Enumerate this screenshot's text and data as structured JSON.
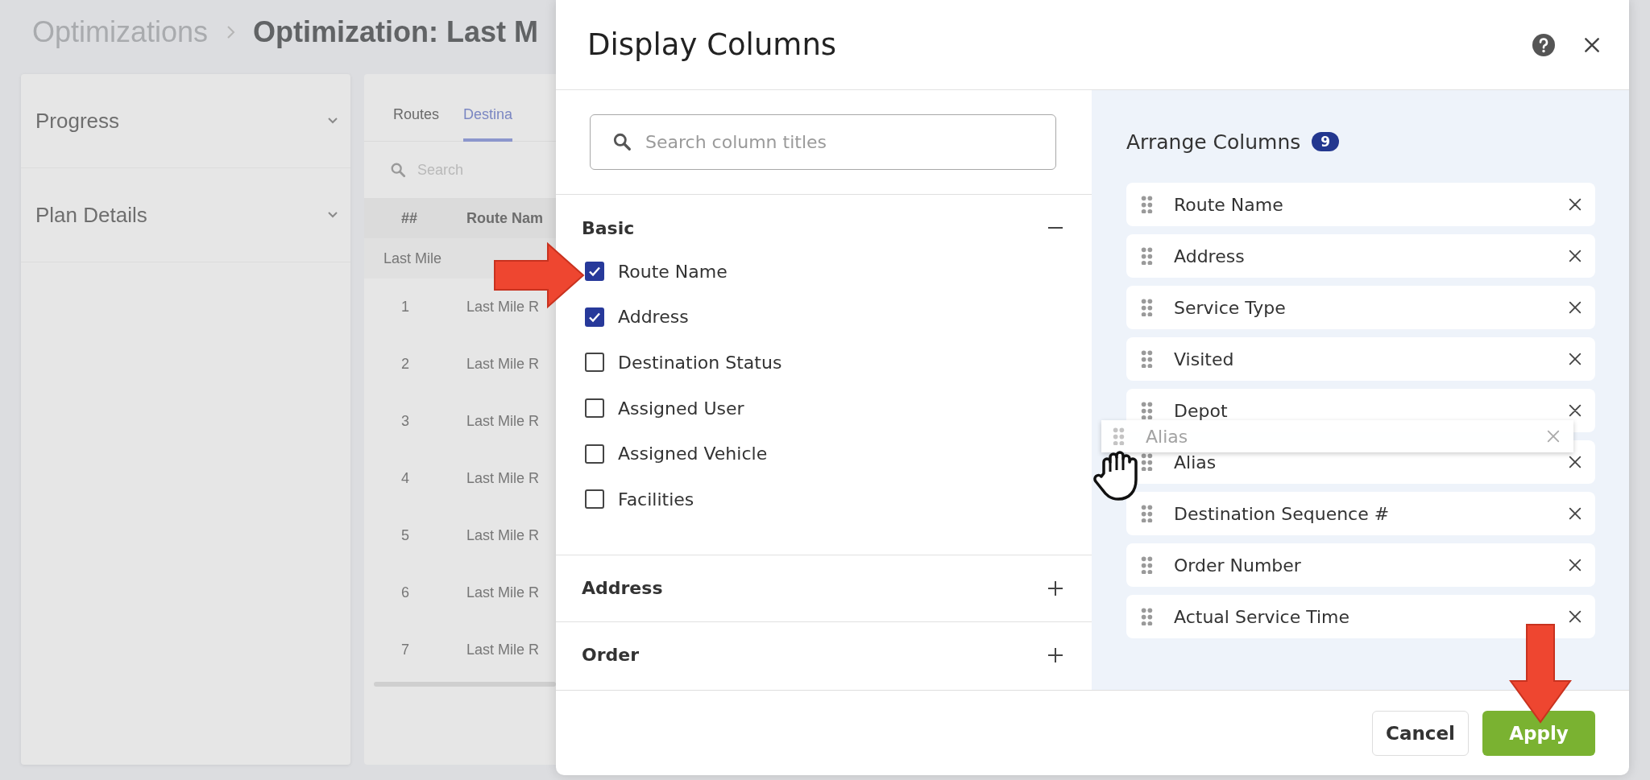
{
  "breadcrumb": [
    {
      "label": "Optimizations"
    },
    {
      "label": "Optimization: Last M"
    }
  ],
  "sidebar": {
    "sections": [
      {
        "label": "Progress"
      },
      {
        "label": "Plan Details"
      }
    ]
  },
  "tabs": [
    {
      "label": "Routes",
      "selected": false
    },
    {
      "label": "Destina",
      "selected": true
    }
  ],
  "table_search": {
    "placeholder": "Search"
  },
  "table": {
    "columns": [
      "##",
      "Route Nam"
    ],
    "group_row": "Last Mile",
    "rows": [
      {
        "number": "1",
        "route": "Last Mile R"
      },
      {
        "number": "2",
        "route": "Last Mile R"
      },
      {
        "number": "3",
        "route": "Last Mile R"
      },
      {
        "number": "4",
        "route": "Last Mile R"
      },
      {
        "number": "5",
        "route": "Last Mile R"
      },
      {
        "number": "6",
        "route": "Last Mile R"
      },
      {
        "number": "7",
        "route": "Last Mile R"
      }
    ]
  },
  "dialog": {
    "title": "Display Columns",
    "search": {
      "placeholder": "Search column titles"
    },
    "sections": [
      {
        "label": "Basic",
        "expanded": true,
        "items": [
          {
            "label": "Route Name",
            "checked": true
          },
          {
            "label": "Address",
            "checked": true
          },
          {
            "label": "Destination Status",
            "checked": false
          },
          {
            "label": "Assigned User",
            "checked": false
          },
          {
            "label": "Assigned Vehicle",
            "checked": false
          },
          {
            "label": "Facilities",
            "checked": false
          }
        ]
      },
      {
        "label": "Address",
        "expanded": false
      },
      {
        "label": "Order",
        "expanded": false
      }
    ],
    "arrange": {
      "title": "Arrange Columns",
      "count": "9",
      "items": [
        {
          "label": "Route Name"
        },
        {
          "label": "Address"
        },
        {
          "label": "Service Type"
        },
        {
          "label": "Visited"
        },
        {
          "label": "Depot"
        },
        {
          "label": "Alias"
        },
        {
          "label": "Destination Sequence #"
        },
        {
          "label": "Order Number"
        },
        {
          "label": "Actual Service Time"
        }
      ]
    },
    "dragging": {
      "label": "Alias"
    },
    "buttons": [
      {
        "label": "Cancel",
        "kind": "secondary"
      },
      {
        "label": "Apply",
        "kind": "primary"
      }
    ]
  }
}
